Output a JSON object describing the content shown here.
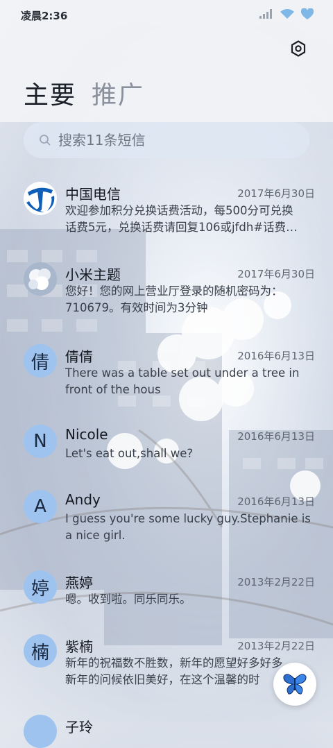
{
  "status_bar": {
    "time": "凌晨2:36",
    "icons": [
      "signal-icon",
      "wifi-icon",
      "battery-icon"
    ]
  },
  "settings": {
    "icon": "gear-icon"
  },
  "tabs": [
    {
      "label": "主要",
      "active": true
    },
    {
      "label": "推广",
      "active": false
    }
  ],
  "search": {
    "placeholder": "搜索11条短信"
  },
  "messages": [
    {
      "sender": "中国电信",
      "date": "2017年6月30日",
      "preview_line1": "欢迎参加积分兑换话费活动，每500分可兑换",
      "preview_line2": "话费5元，兑换话费请回复106或jfdh#话费…",
      "avatar": "china-telecom-logo"
    },
    {
      "sender": "小米主题",
      "date": "2017年6月30日",
      "preview_line1": "您好！您的网上营业厅登录的随机密码为：",
      "preview_line2": "710679。有效时间为3分钟",
      "avatar": "flower-photo"
    },
    {
      "sender": "倩倩",
      "date": "2016年6月13日",
      "preview_line1": "There was a table set out under a tree in",
      "preview_line2": "front of the hous",
      "avatar_letter": "倩"
    },
    {
      "sender": "Nicole",
      "date": "2016年6月13日",
      "preview_line1": "Let's eat out,shall we?",
      "preview_line2": "",
      "avatar_letter": "N"
    },
    {
      "sender": "Andy",
      "date": "2016年6月13日",
      "preview_line1": "I guess you're some lucky guy.Stephanie is",
      "preview_line2": "a nice girl.",
      "avatar_letter": "A"
    },
    {
      "sender": "燕婷",
      "date": "2013年2月22日",
      "preview_line1": "嗯。收到啦。同乐同乐。",
      "preview_line2": "",
      "avatar_letter": "婷"
    },
    {
      "sender": "紫楠",
      "date": "2013年2月22日",
      "preview_line1": "新年的祝福数不胜数，新年的愿望好多好多",
      "preview_line2": "新年的问候依旧美好，在这个温馨的时",
      "avatar_letter": "楠"
    },
    {
      "sender": "子玲",
      "date": "",
      "preview_line1": "",
      "preview_line2": "",
      "avatar_letter": ""
    }
  ],
  "fab": {
    "icon": "butterfly-icon"
  },
  "colors": {
    "avatar_bg": "#9fc3ef",
    "telecom_blue": "#0f5fb8"
  }
}
